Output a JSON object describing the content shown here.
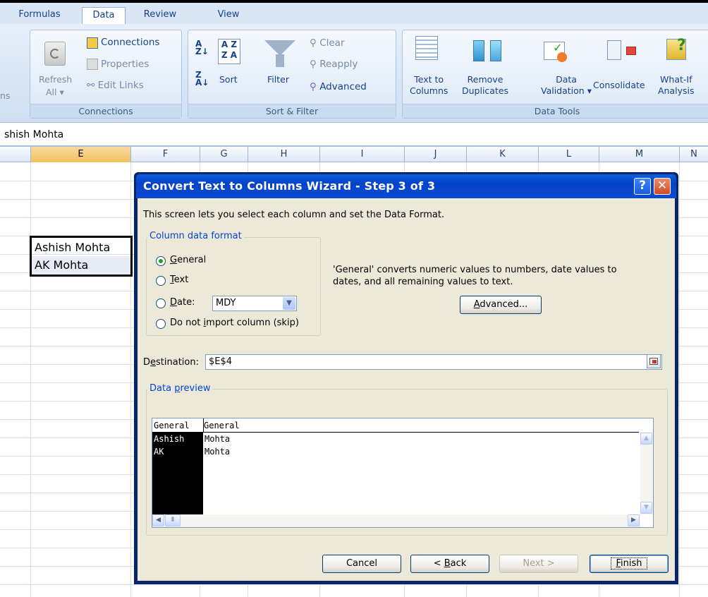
{
  "tabs": [
    {
      "label": "Formulas"
    },
    {
      "label": "Data"
    },
    {
      "label": "Review"
    },
    {
      "label": "View"
    }
  ],
  "ribbon": {
    "left_cut": "ns",
    "connections_group": {
      "label": "Connections",
      "refresh_all": "Refresh",
      "refresh_all_2": "All",
      "connections": "Connections",
      "properties": "Properties",
      "edit_links": "Edit Links"
    },
    "sort_filter_group": {
      "label": "Sort & Filter",
      "sort": "Sort",
      "filter": "Filter",
      "clear": "Clear",
      "reapply": "Reapply",
      "advanced": "Advanced"
    },
    "data_tools_group": {
      "label": "Data Tools",
      "text_to_columns_1": "Text to",
      "text_to_columns_2": "Columns",
      "remove_dup_1": "Remove",
      "remove_dup_2": "Duplicates",
      "validation_1": "Data",
      "validation_2": "Validation",
      "consolidate": "Consolidate",
      "whatif_1": "What-If",
      "whatif_2": "Analysis"
    }
  },
  "formula_bar": {
    "text": "shish Mohta"
  },
  "columns": [
    "E",
    "F",
    "G",
    "H",
    "I",
    "J",
    "K",
    "L",
    "M",
    "N"
  ],
  "cells": {
    "e4": "Ashish Mohta",
    "e5": "AK Mohta"
  },
  "dialog": {
    "title": "Convert Text to Columns Wizard - Step 3 of 3",
    "help_glyph": "?",
    "close_glyph": "✕",
    "intro": "This screen lets you select each column and set the Data Format.",
    "column_format_legend": "Column data format",
    "general": "eneral",
    "general_key": "G",
    "text": "ext",
    "text_key": "T",
    "date": "ate:",
    "date_key": "D",
    "date_value": "MDY",
    "skip_pre": "Do not ",
    "skip_key": "i",
    "skip_post": "mport column (skip)",
    "general_note_1": "'General' converts numeric values to numbers, date values to",
    "general_note_2": "dates, and all remaining values to text.",
    "advanced_key": "A",
    "advanced": "dvanced...",
    "destination_pre": "D",
    "destination_key": "e",
    "destination_post": "stination:",
    "destination_value": "$E$4",
    "preview_legend_pre": "Data ",
    "preview_legend_key": "p",
    "preview_legend_post": "review",
    "preview_headers": [
      "General",
      "General"
    ],
    "preview_rows": [
      [
        "Ashish",
        "Mohta"
      ],
      [
        "AK",
        "Mohta"
      ]
    ],
    "cancel": "Cancel",
    "back_pre": "< ",
    "back_key": "B",
    "back_post": "ack",
    "next": "Next >",
    "finish_key": "F",
    "finish": "inish"
  }
}
